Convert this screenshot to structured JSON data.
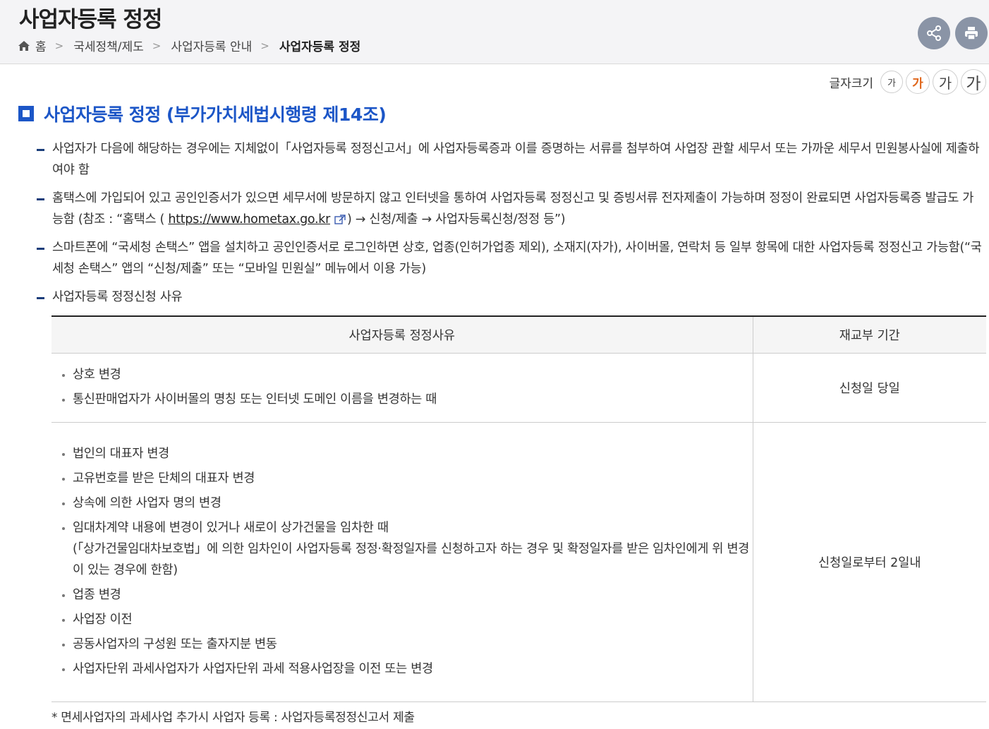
{
  "header": {
    "title": "사업자등록 정정",
    "breadcrumb": [
      "홈",
      "국세정책/제도",
      "사업자등록 안내",
      "사업자등록 정정"
    ],
    "share_icon": "share-icon",
    "print_icon": "print-icon"
  },
  "fontsize": {
    "label": "글자크기",
    "options": [
      "가",
      "가",
      "가",
      "가"
    ],
    "active_color": "#e0661b"
  },
  "section": {
    "title": "사업자등록 정정 (부가가치세법시행령 제14조)",
    "accent": "#1c56c7"
  },
  "bullets": {
    "b1": "사업자가 다음에 해당하는 경우에는 지체없이「사업자등록 정정신고서」에 사업자등록증과 이를 증명하는 서류를 첨부하여 사업장 관할 세무서 또는 가까운 세무서 민원봉사실에 제출하여야 함",
    "b2_pre": "홈택스에 가입되어 있고 공인인증서가 있으면 세무서에 방문하지 않고 인터넷을 통하여 사업자등록 정정신고 및 증빙서류 전자제출이 가능하며 정정이 완료되면 사업자등록증 발급도 가능함 (참조 : “홈택스 ( ",
    "b2_link": "https://www.hometax.go.kr",
    "b2_post": ") → 신청/제출 → 사업자등록신청/정정 등”)",
    "b3": "스마트폰에 “국세청 손택스” 앱을 설치하고 공인인증서로 로그인하면 상호, 업종(인허가업종 제외), 소재지(자가), 사이버몰, 연락처 등 일부 항목에 대한 사업자등록 정정신고 가능함(“국세청 손택스” 앱의 “신청/제출” 또는 “모바일 민원실” 메뉴에서 이용 가능)",
    "b4": "사업자등록 정정신청 사유"
  },
  "table": {
    "headers": [
      "사업자등록 정정사유",
      "재교부 기간"
    ],
    "rows": [
      {
        "reasons": [
          "상호 변경",
          "통신판매업자가 사이버몰의 명칭 또는 인터넷 도메인 이름을 변경하는 때"
        ],
        "period": "신청일 당일"
      },
      {
        "reasons": [
          "법인의 대표자 변경",
          "고유번호를 받은 단체의 대표자 변경",
          "상속에 의한 사업자 명의 변경",
          "임대차계약 내용에 변경이 있거나 새로이 상가건물을 임차한 때",
          "업종 변경",
          "사업장 이전",
          "공동사업자의 구성원 또는 출자지분 변동",
          "사업자단위 과세사업자가 사업자단위 과세 적용사업장을 이전 또는 변경"
        ],
        "lease_note": "(「상가건물임대차보호법」에 의한 임차인이 사업자등록 정정·확정일자를 신청하고자 하는 경우 및 확정일자를 받은 임차인에게 위 변경이 있는 경우에 한함)",
        "period": "신청일로부터 2일내"
      }
    ]
  },
  "footnote": "* 면세사업자의 과세사업 추가시 사업자 등록 : 사업자등록정정신고서 제출"
}
